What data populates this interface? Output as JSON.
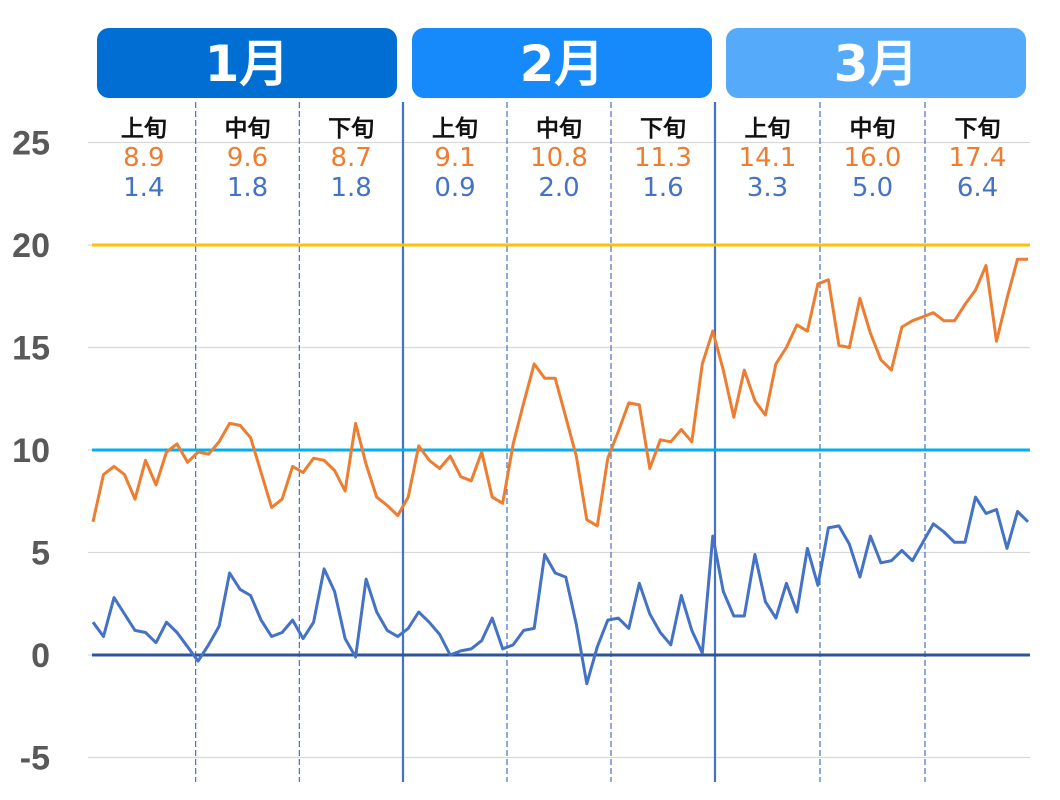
{
  "chart_data": {
    "type": "line",
    "title": "",
    "xlabel": "",
    "ylabel": "",
    "ylim": [
      -5,
      25
    ],
    "yticks": [
      "25",
      "20",
      "15",
      "10",
      "5",
      "0",
      "-5"
    ],
    "ytick_values": [
      25,
      20,
      15,
      10,
      5,
      0,
      -5
    ],
    "grid": true,
    "legend": "none",
    "months": [
      {
        "label": "1月",
        "color": "#006ED2",
        "days": 31,
        "periods": [
          {
            "label": "上旬",
            "avg_high": "8.9",
            "avg_low": "1.4"
          },
          {
            "label": "中旬",
            "avg_high": "9.6",
            "avg_low": "1.8"
          },
          {
            "label": "下旬",
            "avg_high": "8.7",
            "avg_low": "1.8"
          }
        ]
      },
      {
        "label": "2月",
        "color": "#168AFA",
        "days": 28,
        "periods": [
          {
            "label": "上旬",
            "avg_high": "9.1",
            "avg_low": "0.9"
          },
          {
            "label": "中旬",
            "avg_high": "10.8",
            "avg_low": "2.0"
          },
          {
            "label": "下旬",
            "avg_high": "11.3",
            "avg_low": "1.6"
          }
        ]
      },
      {
        "label": "3月",
        "color": "#55AAFA",
        "days": 31,
        "periods": [
          {
            "label": "上旬",
            "avg_high": "14.1",
            "avg_low": "3.3"
          },
          {
            "label": "中旬",
            "avg_high": "16.0",
            "avg_low": "5.0"
          },
          {
            "label": "下旬",
            "avg_high": "17.4",
            "avg_low": "6.4"
          }
        ]
      }
    ],
    "reference_lines": [
      {
        "name": "20-degree-line",
        "value": 20,
        "color": "#FFC000"
      },
      {
        "name": "10-degree-line",
        "value": 10,
        "color": "#00B0F0"
      },
      {
        "name": "0-degree-line",
        "value": 0,
        "color": "#2F5597"
      }
    ],
    "series": [
      {
        "name": "daily-high",
        "color": "#ED7D31",
        "values": [
          6.5,
          8.8,
          9.2,
          8.8,
          7.6,
          9.5,
          8.3,
          9.9,
          10.3,
          9.4,
          9.9,
          9.8,
          10.4,
          11.3,
          11.2,
          10.6,
          8.9,
          7.2,
          7.6,
          9.2,
          8.9,
          9.6,
          9.5,
          9.0,
          8.0,
          11.3,
          9.3,
          7.7,
          7.3,
          6.8,
          7.7,
          10.2,
          9.5,
          9.1,
          9.7,
          8.7,
          8.5,
          9.9,
          7.7,
          7.4,
          10.3,
          12.3,
          14.2,
          13.5,
          13.5,
          11.6,
          9.7,
          6.6,
          6.3,
          9.6,
          10.9,
          12.3,
          12.2,
          9.1,
          10.5,
          10.4,
          11.0,
          10.4,
          14.2,
          15.8,
          13.9,
          11.6,
          13.9,
          12.4,
          11.7,
          14.2,
          15.0,
          16.1,
          15.8,
          18.1,
          18.3,
          15.1,
          15.0,
          17.4,
          15.7,
          14.4,
          13.9,
          16.0,
          16.3,
          16.5,
          16.7,
          16.3,
          16.3,
          17.1,
          17.8,
          19.0,
          15.3,
          17.4,
          19.3,
          19.3
        ]
      },
      {
        "name": "daily-low",
        "color": "#4472C4",
        "values": [
          1.6,
          0.9,
          2.8,
          2.0,
          1.2,
          1.1,
          0.6,
          1.6,
          1.1,
          0.4,
          -0.3,
          0.5,
          1.4,
          4.0,
          3.2,
          2.9,
          1.7,
          0.9,
          1.1,
          1.7,
          0.8,
          1.6,
          4.2,
          3.1,
          0.8,
          -0.1,
          3.7,
          2.1,
          1.2,
          0.9,
          1.3,
          2.1,
          1.6,
          1.0,
          0.0,
          0.2,
          0.3,
          0.7,
          1.8,
          0.3,
          0.5,
          1.2,
          1.3,
          4.9,
          4.0,
          3.8,
          1.5,
          -1.4,
          0.4,
          1.7,
          1.8,
          1.3,
          3.5,
          2.0,
          1.1,
          0.5,
          2.9,
          1.2,
          0.1,
          5.8,
          3.1,
          1.9,
          1.9,
          4.9,
          2.6,
          1.8,
          3.5,
          2.1,
          5.2,
          3.4,
          6.2,
          6.3,
          5.4,
          3.8,
          5.8,
          4.5,
          4.6,
          5.1,
          4.6,
          5.5,
          6.4,
          6.0,
          5.5,
          5.5,
          7.7,
          6.9,
          7.1,
          5.2,
          7.0,
          6.5
        ]
      }
    ]
  }
}
